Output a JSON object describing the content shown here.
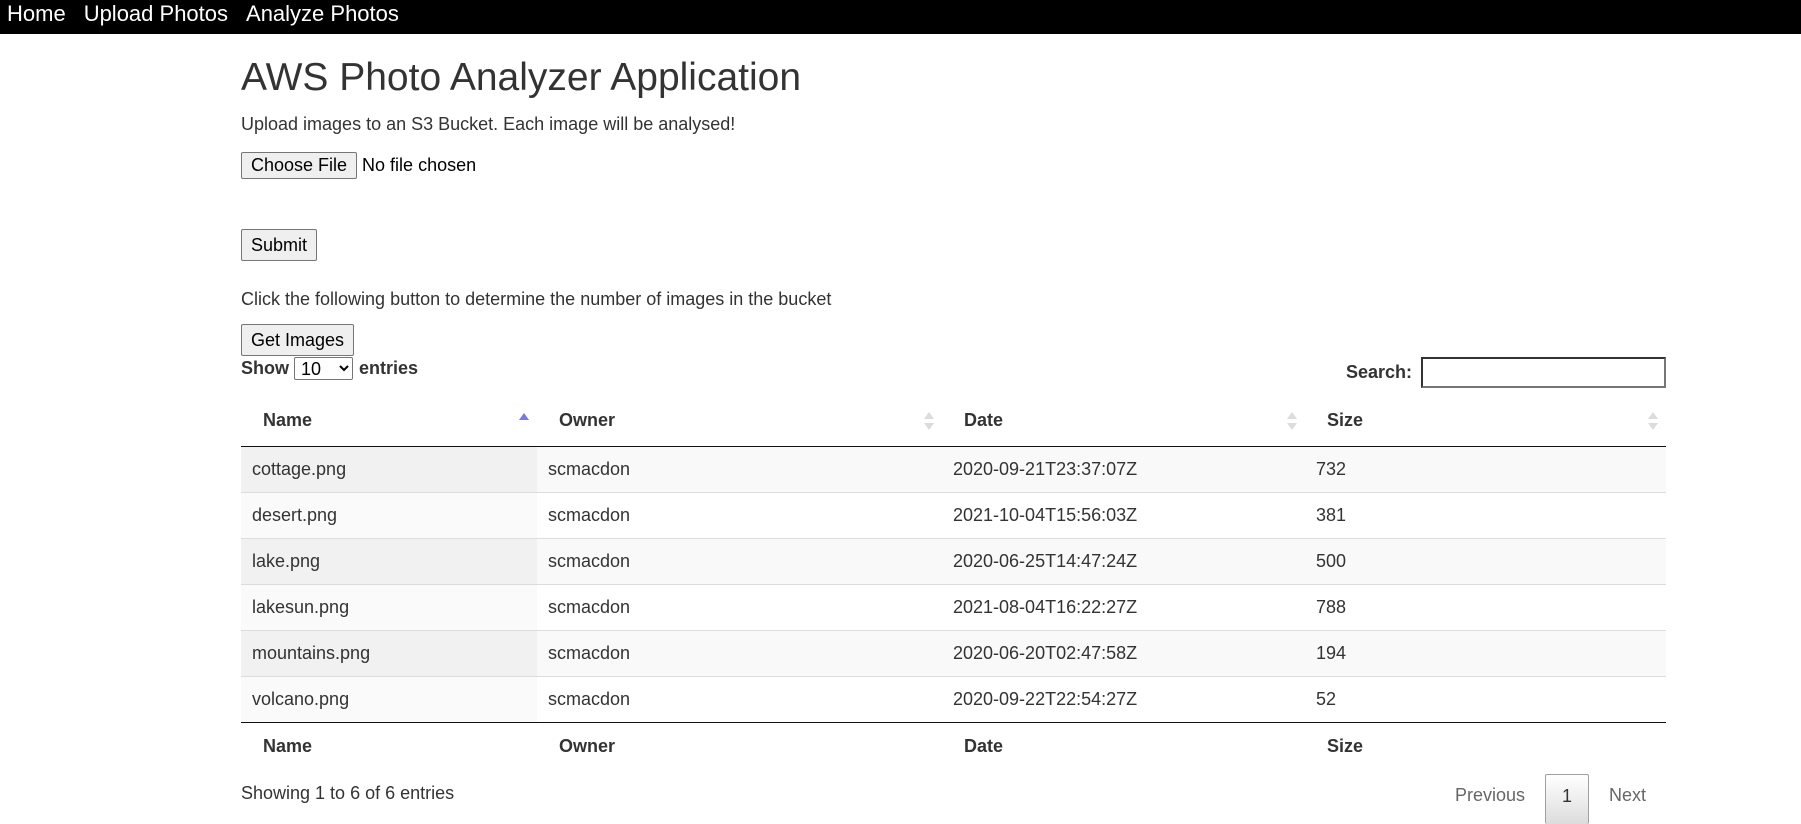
{
  "nav": {
    "items": [
      {
        "label": "Home"
      },
      {
        "label": "Upload Photos"
      },
      {
        "label": "Analyze Photos"
      }
    ]
  },
  "page": {
    "title": "AWS Photo Analyzer Application",
    "intro": "Upload images to an S3 Bucket. Each image will be analysed!",
    "choose_file_label": "Choose File",
    "file_status": "No file chosen",
    "submit_label": "Submit",
    "bucket_text": "Click the following button to determine the number of images in the bucket",
    "get_images_label": "Get Images"
  },
  "table_controls": {
    "show_label": "Show",
    "entries_label": "entries",
    "page_length": "10",
    "search_label": "Search:",
    "search_value": ""
  },
  "table": {
    "columns": [
      {
        "label": "Name",
        "sort": "ascending"
      },
      {
        "label": "Owner",
        "sort": "none"
      },
      {
        "label": "Date",
        "sort": "none"
      },
      {
        "label": "Size",
        "sort": "none"
      }
    ],
    "rows": [
      {
        "name": "cottage.png",
        "owner": "scmacdon",
        "date": "2020-09-21T23:37:07Z",
        "size": "732"
      },
      {
        "name": "desert.png",
        "owner": "scmacdon",
        "date": "2021-10-04T15:56:03Z",
        "size": "381"
      },
      {
        "name": "lake.png",
        "owner": "scmacdon",
        "date": "2020-06-25T14:47:24Z",
        "size": "500"
      },
      {
        "name": "lakesun.png",
        "owner": "scmacdon",
        "date": "2021-08-04T16:22:27Z",
        "size": "788"
      },
      {
        "name": "mountains.png",
        "owner": "scmacdon",
        "date": "2020-06-20T02:47:58Z",
        "size": "194"
      },
      {
        "name": "volcano.png",
        "owner": "scmacdon",
        "date": "2020-09-22T22:54:27Z",
        "size": "52"
      }
    ]
  },
  "footer": {
    "info": "Showing 1 to 6 of 6 entries",
    "previous_label": "Previous",
    "current_page": "1",
    "next_label": "Next"
  },
  "colors": {
    "nav_background": "#000000",
    "sort_active": "#7a7ad8",
    "sort_inactive": "#dcdcdc"
  }
}
